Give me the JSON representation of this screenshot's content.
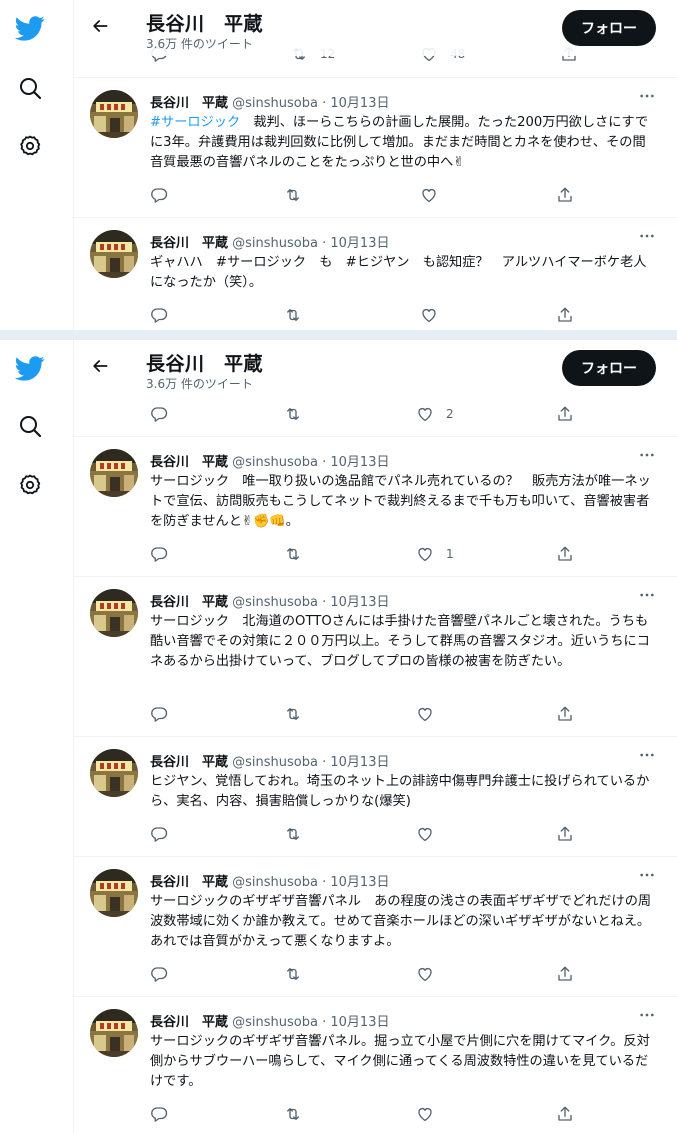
{
  "colors": {
    "brand": "#1d9bf0",
    "text": "#0f1419",
    "muted": "#536471",
    "border": "#eff3f4"
  },
  "nav": {
    "icons": [
      "twitter-bird-icon",
      "search-icon",
      "settings-gear-icon"
    ]
  },
  "header": {
    "title": "長谷川　平蔵",
    "subtitle": "3.6万 件のツイート",
    "follow_label": "フォロー"
  },
  "top": {
    "partial_actions": {
      "retweets": "12",
      "likes": "48"
    },
    "tweets": [
      {
        "name": "長谷川　平蔵",
        "handle": "@sinshusoba",
        "date": "10月13日",
        "hashtag": "#サーロジック",
        "text": "　裁判、ほーらこちらの計画した展開。たった200万円欲しさにすでに3年。弁護費用は裁判回数に比例して増加。まだまだ時間とカネを使わせ、その間音質最悪の音響パネルのことをたっぷりと世の中へ✌",
        "like_count": ""
      },
      {
        "name": "長谷川　平蔵",
        "handle": "@sinshusoba",
        "date": "10月13日",
        "text": "ギャハハ　#サーロジック　も　#ヒジヤン　も認知症？　アルツハイマーボケ老人になったか（笑）。",
        "like_count": ""
      }
    ]
  },
  "bottom": {
    "partial_actions": {
      "retweets": "",
      "likes": "2"
    },
    "tweets": [
      {
        "name": "長谷川　平蔵",
        "handle": "@sinshusoba",
        "date": "10月13日",
        "text": "サーロジック　唯一取り扱いの逸品館でパネル売れているの？　販売方法が唯一ネットで宣伝、訪問販売もこうしてネットで裁判終えるまで千も万も叩いて、音響被害者を防ぎませんと✌✊👊。",
        "like_count": "1"
      },
      {
        "name": "長谷川　平蔵",
        "handle": "@sinshusoba",
        "date": "10月13日",
        "text": "サーロジック　北海道のOTTOさんには手掛けた音響壁パネルごと壊された。うちも酷い音響でその対策に２００万円以上。そうして群馬の音響スタジオ。近いうちにコネあるから出掛けていって、ブログしてプロの皆様の被害を防ぎたい。",
        "like_count": ""
      },
      {
        "name": "長谷川　平蔵",
        "handle": "@sinshusoba",
        "date": "10月13日",
        "text": "ヒジヤン、覚悟しておれ。埼玉のネット上の誹謗中傷専門弁護士に投げられているから、実名、内容、損害賠償しっかりな(爆笑)",
        "like_count": ""
      },
      {
        "name": "長谷川　平蔵",
        "handle": "@sinshusoba",
        "date": "10月13日",
        "text": "サーロジックのギザギザ音響パネル　あの程度の浅さの表面ギザギザでどれだけの周波数帯域に効くか誰か教えて。せめて音楽ホールほどの深いギザギザがないとねえ。あれでは音質がかえって悪くなりますよ。",
        "like_count": ""
      },
      {
        "name": "長谷川　平蔵",
        "handle": "@sinshusoba",
        "date": "10月13日",
        "text": "サーロジックのギザギザ音響パネル。掘っ立て小屋で片側に穴を開けてマイク。反対側からサブウーハー鳴らして、マイク側に通ってくる周波数特性の違いを見ているだけです。",
        "like_count": ""
      }
    ]
  }
}
